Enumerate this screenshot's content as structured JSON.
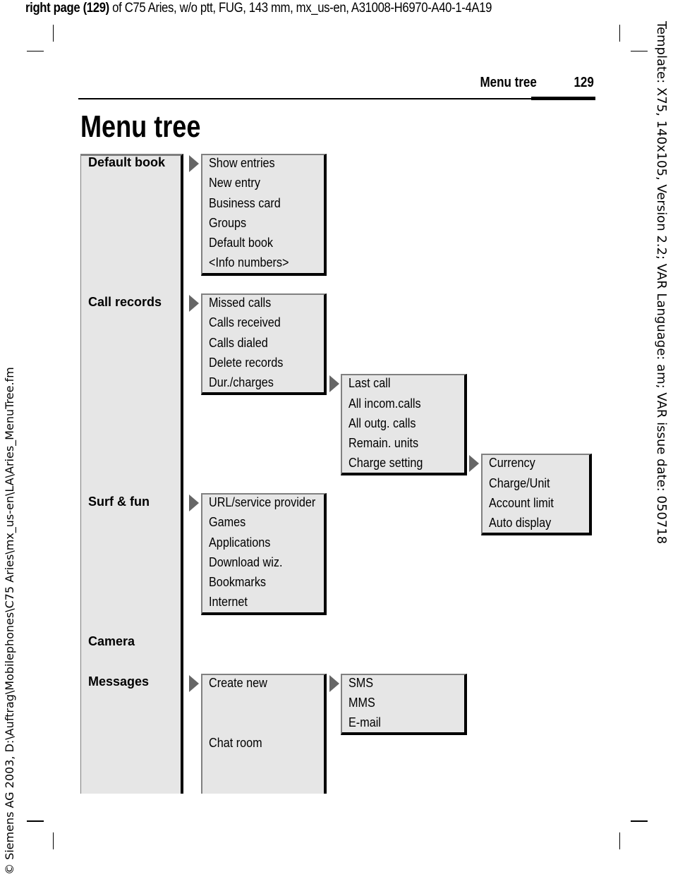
{
  "print_header": {
    "bold_part": "right page (129)",
    "rest": " of C75 Aries, w/o ptt, FUG, 143 mm, mx_us-en, A31008-H6970-A40-1-4A19"
  },
  "side_text_left": "© Siemens AG 2003, D:\\Auftrag\\Mobilephones\\C75 Aries\\mx_us-en\\LA\\Aries_MenuTree.fm",
  "side_text_right": "Template: X75, 140x105, Version 2.2; VAR Language: am; VAR issue date: 050718",
  "running_head": {
    "title": "Menu tree",
    "page": "129"
  },
  "page_title": "Menu tree",
  "menu": {
    "main": [
      "Default book",
      "Call records",
      "Surf & fun",
      "Camera",
      "Messages"
    ],
    "default_book": [
      "Show entries",
      "New entry",
      "Business card",
      "Groups",
      "Default book",
      "<Info numbers>"
    ],
    "call_records": [
      "Missed calls",
      "Calls received",
      "Calls dialed",
      "Delete records",
      "Dur./charges"
    ],
    "dur_charges": [
      "Last call",
      "All incom.calls",
      "All outg. calls",
      "Remain. units",
      "Charge setting"
    ],
    "charge_setting": [
      "Currency",
      "Charge/Unit",
      "Account limit",
      "Auto display"
    ],
    "surf_fun": [
      "URL/service provider",
      "Games",
      "Applications",
      "Download wiz.",
      "Bookmarks",
      "Internet"
    ],
    "messages": [
      "Create new",
      "Chat room"
    ],
    "create_new": [
      "SMS",
      "MMS",
      "E-mail"
    ]
  },
  "colors": {
    "box_fill": "#e6e6e6",
    "arrow": "#666666",
    "box_shadow_border": "#000000",
    "box_light_border": "#808080"
  }
}
